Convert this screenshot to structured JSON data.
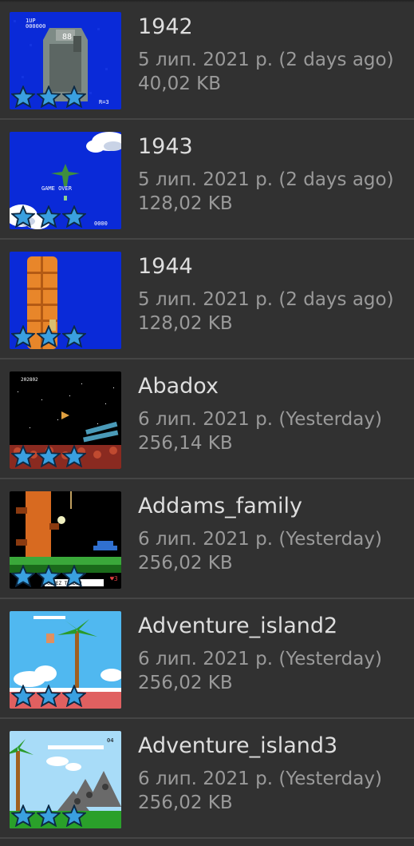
{
  "games": [
    {
      "title": "1942",
      "date": "5 лип. 2021 р. (2 days ago)",
      "size": "40,02 KB",
      "thumb": "blue-carrier",
      "stars": 3
    },
    {
      "title": "1943",
      "date": "5 лип. 2021 р. (2 days ago)",
      "size": "128,02 KB",
      "thumb": "blue-clouds",
      "stars": 3
    },
    {
      "title": "1944",
      "date": "5 лип. 2021 р. (2 days ago)",
      "size": "128,02 KB",
      "thumb": "blue-tower",
      "stars": 3
    },
    {
      "title": "Abadox",
      "date": "6 лип. 2021 р. (Yesterday)",
      "size": "256,14 KB",
      "thumb": "space",
      "stars": 3
    },
    {
      "title": "Addams_family",
      "date": "6 лип. 2021 р. (Yesterday)",
      "size": "256,02 KB",
      "thumb": "night-tree",
      "stars": 3
    },
    {
      "title": "Adventure_island2",
      "date": "6 лип. 2021 р. (Yesterday)",
      "size": "256,02 KB",
      "thumb": "beach",
      "stars": 3
    },
    {
      "title": "Adventure_island3",
      "date": "6 лип. 2021 р. (Yesterday)",
      "size": "256,02 KB",
      "thumb": "jungle",
      "stars": 3
    }
  ],
  "colors": {
    "background": "#313131",
    "title_text": "#dedede",
    "secondary_text": "#9a9a9a",
    "divider": "#454545",
    "star_fill": "#3aa0e0",
    "star_stroke": "#0d2a45"
  }
}
